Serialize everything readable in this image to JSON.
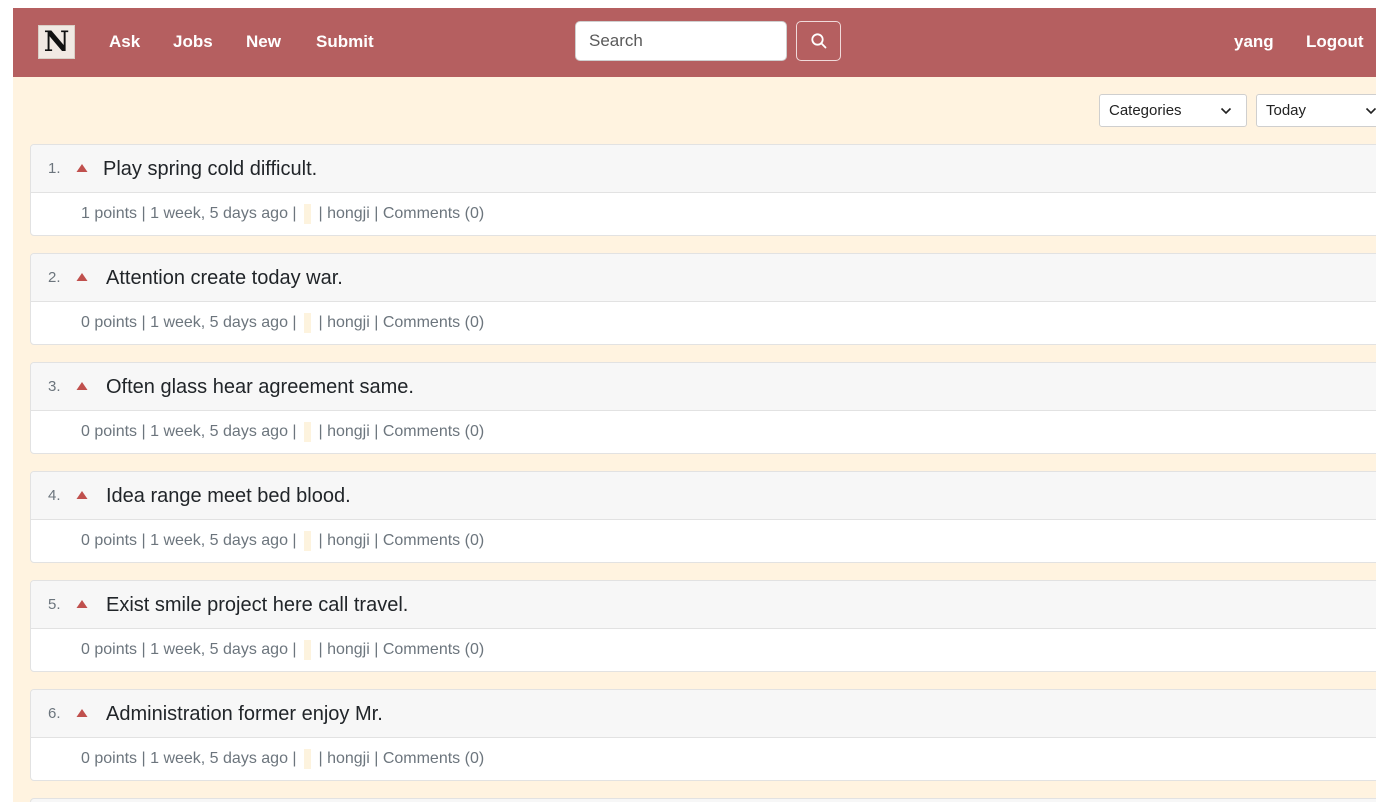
{
  "navbar": {
    "logo": "N",
    "links": [
      "Ask",
      "Jobs",
      "New",
      "Submit"
    ],
    "search_placeholder": "Search",
    "user": "yang",
    "logout": "Logout",
    "background_color": "#b55f60"
  },
  "filters": {
    "category_selected": "Categories",
    "time_selected": "Today"
  },
  "stories": [
    {
      "rank": "1.",
      "title": "Play spring cold difficult.",
      "points": "1 points",
      "age": "1 week, 5 days ago",
      "author": "hongji",
      "comments": "Comments (0)"
    },
    {
      "rank": "2.",
      "title": "Attention create today war.",
      "points": "0 points",
      "age": "1 week, 5 days ago",
      "author": "hongji",
      "comments": "Comments (0)"
    },
    {
      "rank": "3.",
      "title": "Often glass hear agreement same.",
      "points": "0 points",
      "age": "1 week, 5 days ago",
      "author": "hongji",
      "comments": "Comments (0)"
    },
    {
      "rank": "4.",
      "title": "Idea range meet bed blood.",
      "points": "0 points",
      "age": "1 week, 5 days ago",
      "author": "hongji",
      "comments": "Comments (0)"
    },
    {
      "rank": "5.",
      "title": "Exist smile project here call travel.",
      "points": "0 points",
      "age": "1 week, 5 days ago",
      "author": "hongji",
      "comments": "Comments (0)"
    },
    {
      "rank": "6.",
      "title": "Administration former enjoy Mr.",
      "points": "0 points",
      "age": "1 week, 5 days ago",
      "author": "hongji",
      "comments": "Comments (0)"
    }
  ],
  "meta_separator": " | ",
  "colors": {
    "page_background": "#fff3e0",
    "upvote_arrow": "#c0504d"
  },
  "icons": {
    "search": "magnifier-icon",
    "upvote": "triangle-up-icon",
    "dropdown": "chevron-down-icon"
  }
}
